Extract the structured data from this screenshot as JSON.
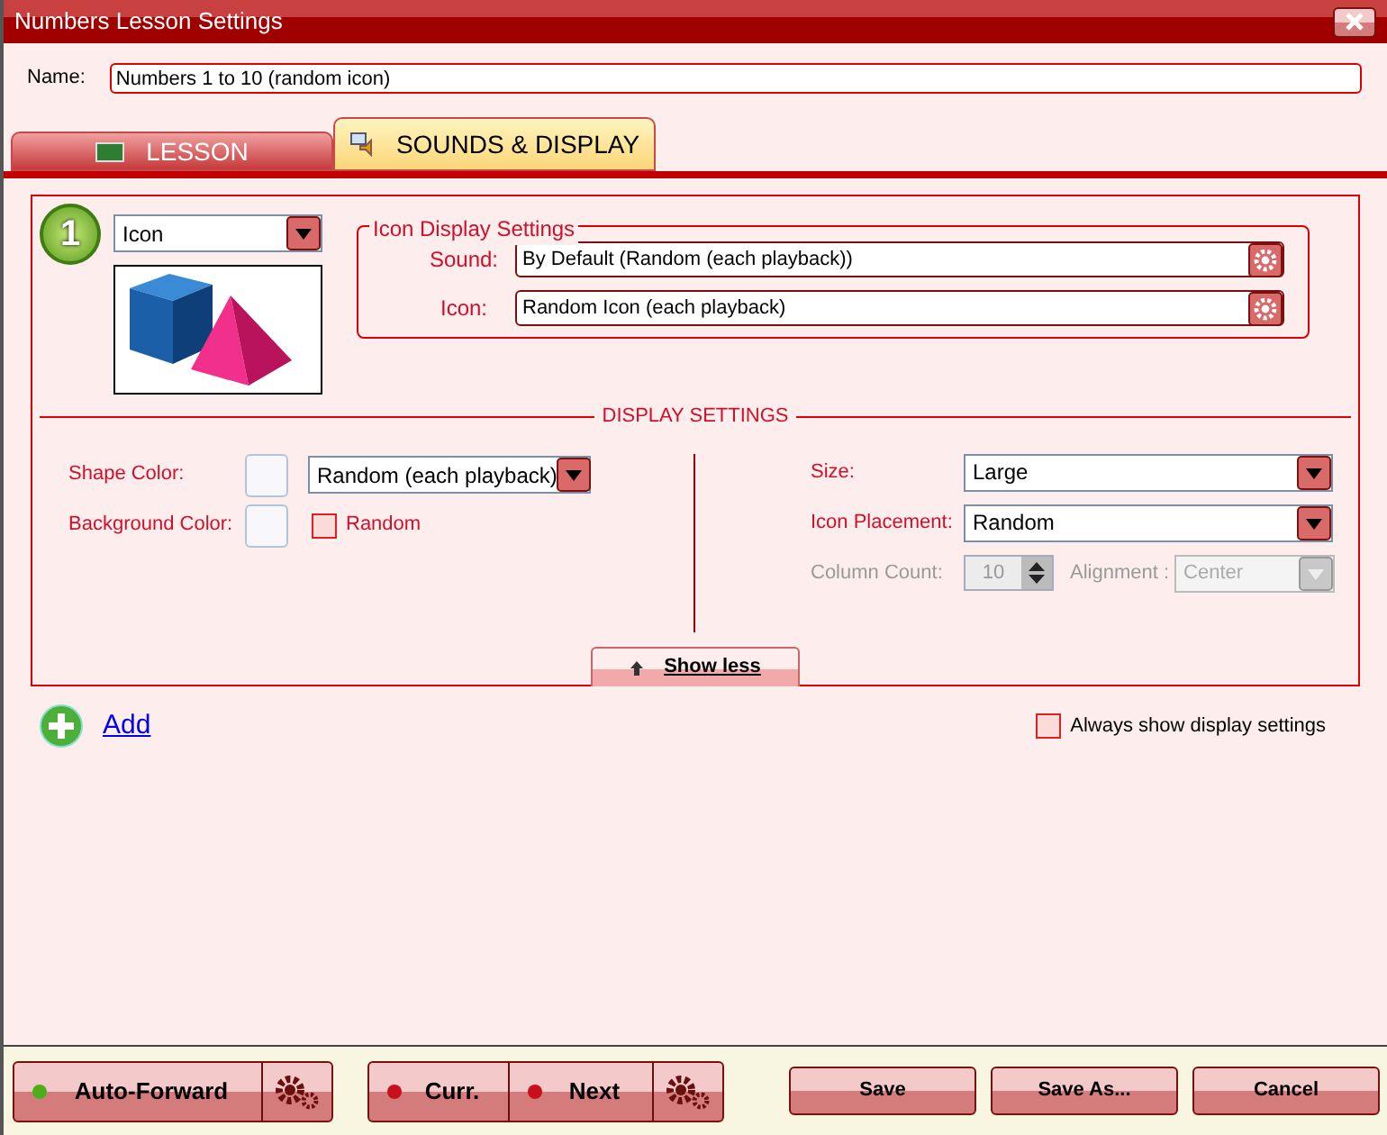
{
  "window": {
    "title": "Numbers Lesson Settings"
  },
  "name_field": {
    "label": "Name:",
    "value": "Numbers 1 to 10 (random icon)"
  },
  "tabs": [
    {
      "label": "LESSON",
      "selected": false
    },
    {
      "label": "SOUNDS & DISPLAY",
      "selected": true
    }
  ],
  "item": {
    "number": "1",
    "type_select": "Icon",
    "icon_display_settings": {
      "title": "Icon Display Settings",
      "fields": [
        {
          "label": "Sound:",
          "value": "By Default (Random (each playback))"
        },
        {
          "label": "Icon:",
          "value": "Random Icon (each playback)"
        }
      ]
    },
    "display_settings": {
      "title": "DISPLAY SETTINGS",
      "shape_color": {
        "label": "Shape Color:",
        "value": "Random (each playback)"
      },
      "background_color": {
        "label": "Background Color:",
        "random_label": "Random",
        "checked": false
      },
      "size": {
        "label": "Size:",
        "value": "Large"
      },
      "icon_placement": {
        "label": "Icon Placement:",
        "value": "Random"
      },
      "column_count": {
        "label": "Column Count:",
        "value": "10",
        "disabled": true
      },
      "alignment": {
        "label": "Alignment :",
        "value": "Center",
        "disabled": true
      }
    },
    "show_less": "Show less"
  },
  "add_link": "Add",
  "always_show": {
    "label": "Always show display settings",
    "checked": false
  },
  "playback_groups": [
    {
      "items": [
        {
          "label": "Auto-Forward",
          "color": "#4caf1a"
        }
      ]
    },
    {
      "items": [
        {
          "label": "Curr.",
          "color": "#c8101c"
        },
        {
          "label": "Next",
          "color": "#c8101c"
        }
      ]
    }
  ],
  "buttons": [
    "Save",
    "Save As...",
    "Cancel"
  ]
}
